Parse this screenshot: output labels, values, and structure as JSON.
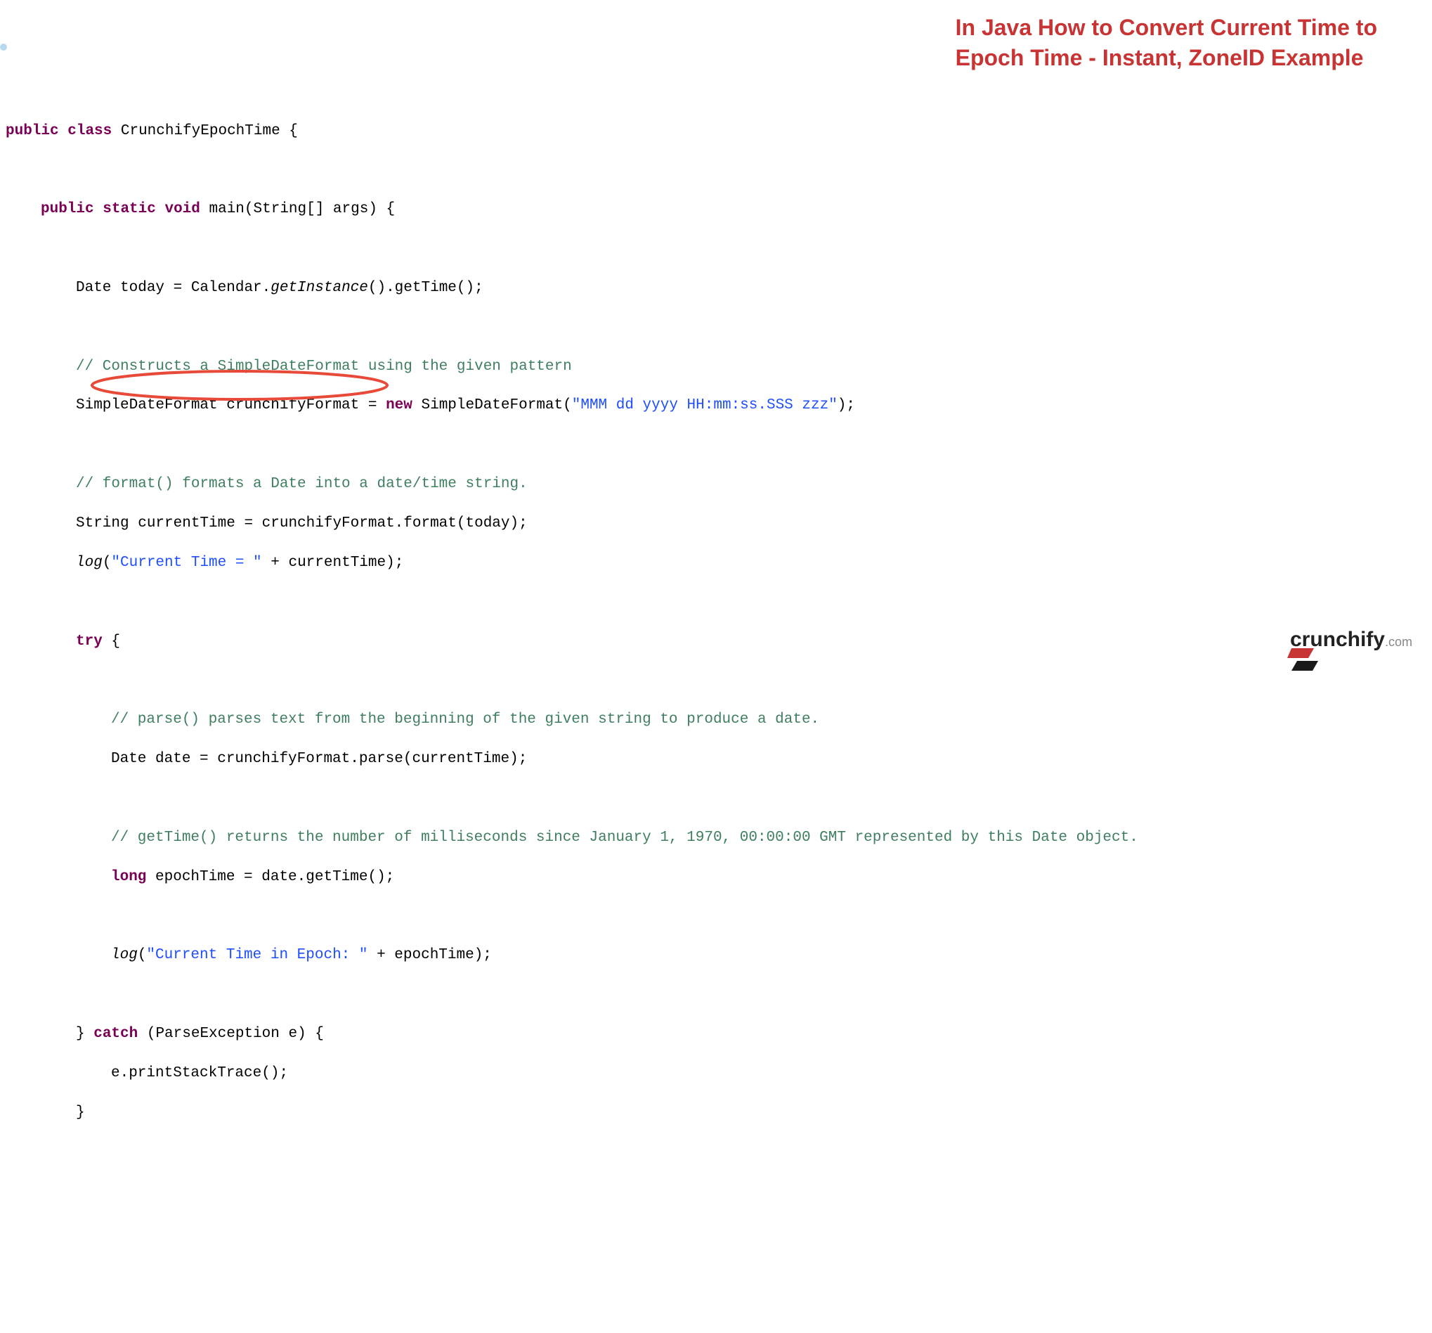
{
  "title": {
    "line1": "In Java How to Convert Current Time to",
    "line2": "Epoch Time - Instant, ZoneID Example"
  },
  "logo": {
    "brand": "crunchify",
    "suffix": ".com"
  },
  "code": {
    "l1": {
      "kw1": "public",
      "kw2": "class",
      "name": "CrunchifyEpochTime {"
    },
    "l2": {
      "kw1": "public",
      "kw2": "static",
      "kw3": "void",
      "rest": "main(String[] args) {"
    },
    "l3": {
      "p1": "Date today = Calendar.",
      "m": "getInstance",
      "p2": "().getTime();"
    },
    "l4": {
      "c": "// Constructs a SimpleDateFormat using the given pattern"
    },
    "l5": {
      "p1": "SimpleDateFormat crunchifyFormat = ",
      "kw": "new",
      "p2": " SimpleDateFormat(",
      "s": "\"MMM dd yyyy HH:mm:ss.SSS zzz\"",
      "p3": ");"
    },
    "l6": {
      "c": "// format() formats a Date into a date/time string."
    },
    "l7": {
      "p": "String currentTime = crunchifyFormat.format(today);"
    },
    "l8": {
      "m": "log",
      "p1": "(",
      "s": "\"Current Time = \"",
      "p2": " + currentTime);"
    },
    "l9": {
      "kw": "try",
      "p": " {"
    },
    "l10": {
      "c": "// parse() parses text from the beginning of the given string to produce a date."
    },
    "l11": {
      "p": "Date date = crunchifyFormat.parse(currentTime);"
    },
    "l12": {
      "c": "// getTime() returns the number of milliseconds since January 1, 1970, 00:00:00 GMT represented by this Date object."
    },
    "l13": {
      "kw": "long",
      "p": " epochTime = date.getTime();"
    },
    "l14": {
      "m": "log",
      "p1": "(",
      "s": "\"Current Time in Epoch: \"",
      "p2": " + epochTime);"
    },
    "l15": {
      "p1": "} ",
      "kw": "catch",
      "p2": " (ParseException e) {"
    },
    "l16": {
      "p": "e.printStackTrace();"
    },
    "l17": {
      "p": "}"
    }
  }
}
